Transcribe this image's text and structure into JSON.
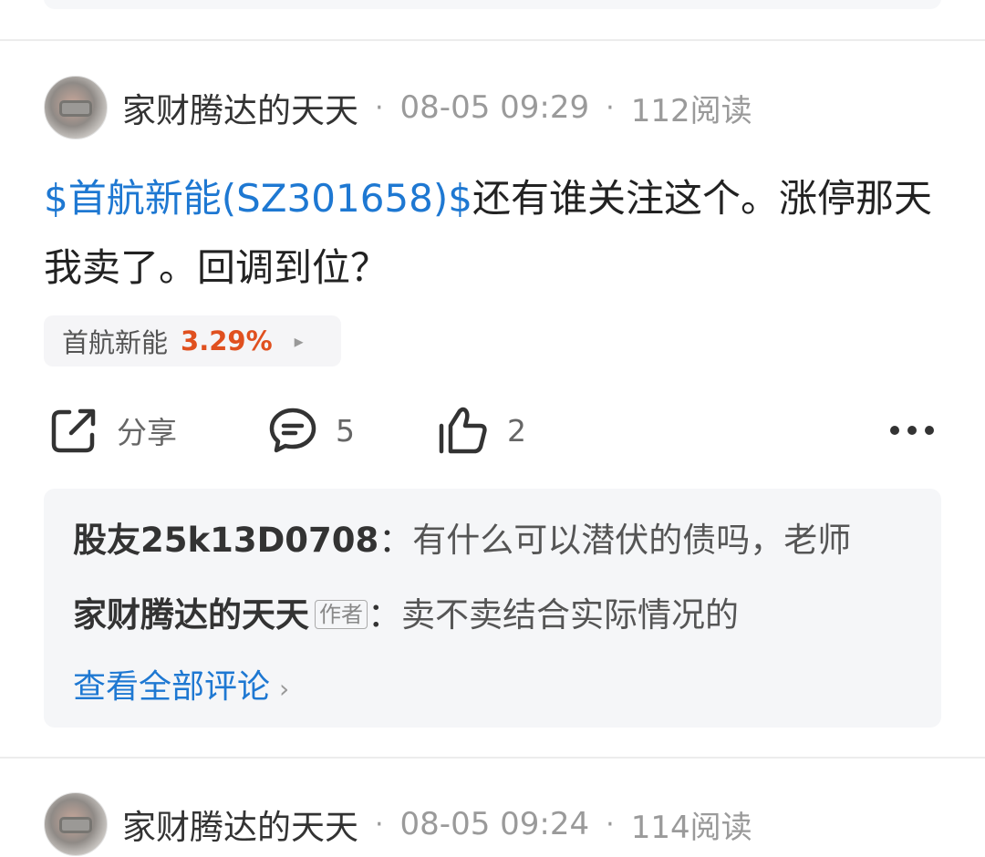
{
  "posts": [
    {
      "author": "家财腾达的天天",
      "separator": "·",
      "time": "08-05 09:29",
      "reads": "112阅读",
      "stock_link": "$首航新能(SZ301658)$",
      "text": "还有谁关注这个。涨停那天我卖了。回调到位？",
      "stock_tag": {
        "name": "首航新能",
        "change": "3.29%",
        "arrow": "▸"
      },
      "actions": {
        "share_label": "分享",
        "comment_count": "5",
        "like_count": "2"
      },
      "comments": [
        {
          "user": "股友25k13D0708",
          "colon": "：",
          "text": "有什么可以潜伏的债吗，老师"
        },
        {
          "user": "家财腾达的天天",
          "badge": "作者",
          "colon": "：",
          "text": "卖不卖结合实际情况的"
        }
      ],
      "view_all": "查看全部评论",
      "view_all_arrow": "›"
    },
    {
      "author": "家财腾达的天天",
      "separator": "·",
      "time": "08-05 09:24",
      "reads": "114阅读"
    }
  ],
  "icons": [
    "share-icon",
    "comment-icon",
    "thumbs-up-icon",
    "more-icon",
    "chevron-right-icon"
  ],
  "colors": {
    "link": "#1e78d2",
    "up": "#e0501f"
  }
}
